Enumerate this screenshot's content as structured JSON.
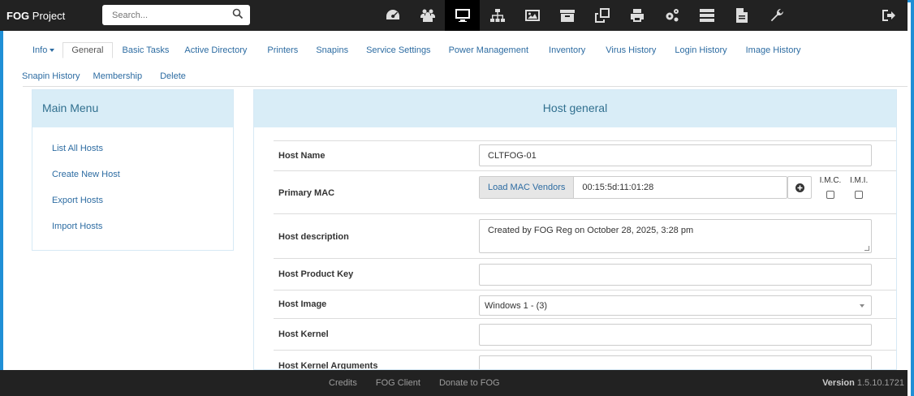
{
  "brand": {
    "bold": "FOG",
    "rest": " Project"
  },
  "search": {
    "placeholder": "Search..."
  },
  "nav_icons": [
    "dashboard-icon",
    "users-icon",
    "desktop-icon",
    "sitemap-icon",
    "image-icon",
    "archive-icon",
    "clone-icon",
    "print-icon",
    "cogs-icon",
    "server-icon",
    "file-icon",
    "wrench-icon"
  ],
  "subnav": {
    "info": "Info",
    "row1": [
      "General",
      "Basic Tasks",
      "Active Directory",
      "Printers",
      "Snapins",
      "Service Settings",
      "Power Management",
      "Inventory",
      "Virus History",
      "Login History",
      "Image History"
    ],
    "row2": [
      "Snapin History",
      "Membership",
      "Delete"
    ]
  },
  "main_menu": {
    "title": "Main Menu",
    "items": [
      "List All Hosts",
      "Create New Host",
      "Export Hosts",
      "Import Hosts"
    ]
  },
  "host_general": {
    "title": "Host general",
    "host_name_label": "Host Name",
    "host_name_value": "CLTFOG-01",
    "primary_mac_label": "Primary MAC",
    "load_mac_vendors": "Load MAC Vendors",
    "mac_value": "00:15:5d:11:01:28",
    "imc_label": "I.M.C.",
    "imi_label": "I.M.I.",
    "description_label": "Host description",
    "description_value": "Created by FOG Reg on October 28, 2025, 3:28 pm",
    "product_key_label": "Host Product Key",
    "product_key_value": "",
    "image_label": "Host Image",
    "image_value": "Windows 1 - (3)",
    "kernel_label": "Host Kernel",
    "kernel_value": "",
    "kernel_args_label": "Host Kernel Arguments",
    "kernel_args_value": ""
  },
  "footer": {
    "links": [
      "Credits",
      "FOG Client",
      "Donate to FOG"
    ],
    "version_label": "Version",
    "version_value": "1.5.10.1721"
  }
}
